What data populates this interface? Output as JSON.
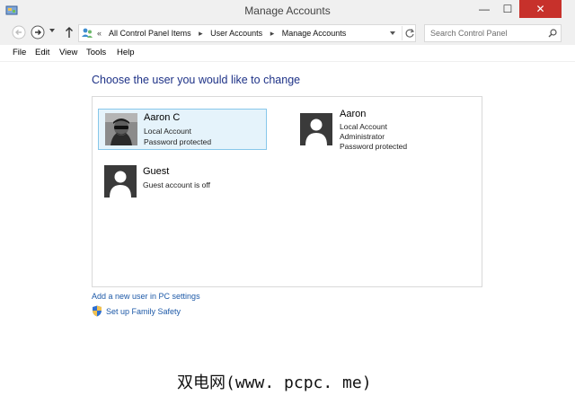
{
  "window": {
    "title": "Manage Accounts",
    "controls": {
      "minimize": "—",
      "maximize": "☐",
      "close": "✕"
    }
  },
  "address_bar": {
    "overflow": "«",
    "breadcrumbs": [
      "All Control Panel Items",
      "User Accounts",
      "Manage Accounts"
    ],
    "separator": "▸"
  },
  "search": {
    "placeholder": "Search Control Panel"
  },
  "menu": [
    "File",
    "Edit",
    "View",
    "Tools",
    "Help"
  ],
  "page": {
    "heading": "Choose the user you would like to change",
    "accounts": [
      {
        "name": "Aaron C",
        "lines": [
          "Local Account",
          "Password protected"
        ],
        "selected": true,
        "avatar": "photo"
      },
      {
        "name": "Aaron",
        "lines": [
          "Local Account",
          "Administrator",
          "Password protected"
        ],
        "selected": false,
        "avatar": "silhouette"
      },
      {
        "name": "Guest",
        "lines": [
          "Guest account is off"
        ],
        "selected": false,
        "avatar": "silhouette"
      }
    ],
    "links": {
      "add_user": "Add a new user in PC settings",
      "family_safety": "Set up Family Safety"
    }
  },
  "watermark": "双电网(www. pcpc. me)",
  "colors": {
    "close_button": "#c7312b",
    "heading": "#1e3287",
    "link": "#1e5aa8",
    "selection": "#e5f3fb"
  }
}
